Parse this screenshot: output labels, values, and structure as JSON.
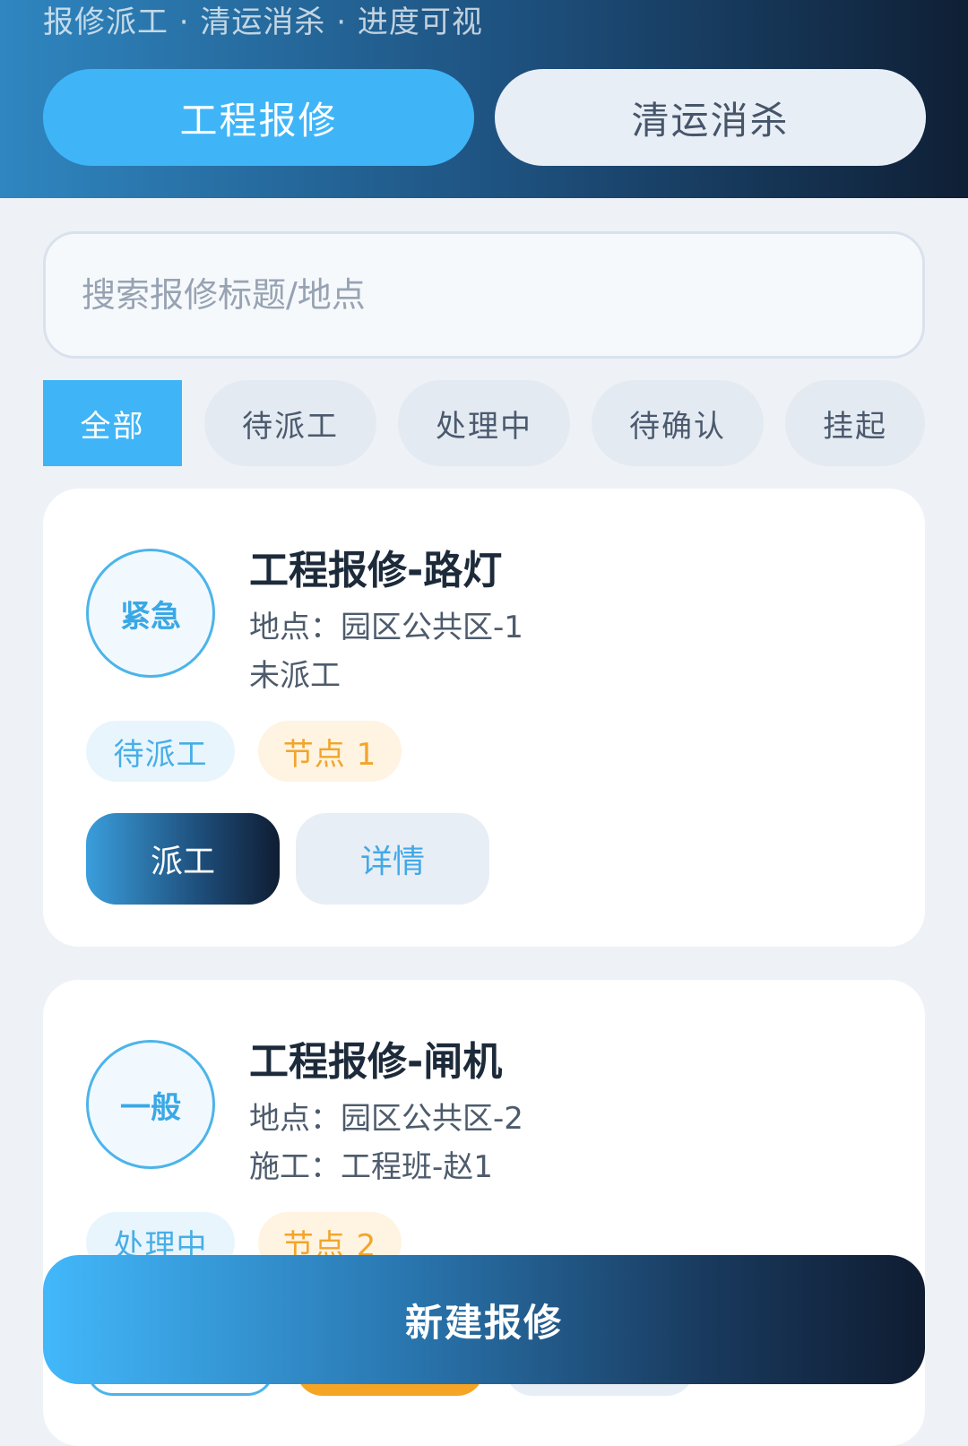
{
  "header": {
    "subtitle": "报修派工 · 清运消杀 · 进度可视",
    "tabs": [
      {
        "label": "工程报修",
        "active": true
      },
      {
        "label": "清运消杀",
        "active": false
      }
    ]
  },
  "search": {
    "placeholder": "搜索报修标题/地点",
    "value": ""
  },
  "filters": [
    {
      "label": "全部",
      "active": true
    },
    {
      "label": "待派工",
      "active": false
    },
    {
      "label": "处理中",
      "active": false
    },
    {
      "label": "待确认",
      "active": false
    },
    {
      "label": "挂起",
      "active": false
    }
  ],
  "orders": [
    {
      "priority": "紧急",
      "title": "工程报修-路灯",
      "location": "地点：园区公共区-1",
      "assignee": "未派工",
      "status": "待派工",
      "node": "节点 1",
      "primary_action": "派工",
      "secondary_action": "详情"
    },
    {
      "priority": "一般",
      "title": "工程报修-闸机",
      "location": "地点：园区公共区-2",
      "assignee": "施工：工程班-赵1",
      "status": "处理中",
      "node": "节点 2"
    }
  ],
  "fab": {
    "label": "新建报修"
  },
  "colors": {
    "accent": "#3fb5f8",
    "header_dark": "#0f1f35",
    "status_blue": "#47aee6",
    "node_orange": "#f1a52b"
  }
}
